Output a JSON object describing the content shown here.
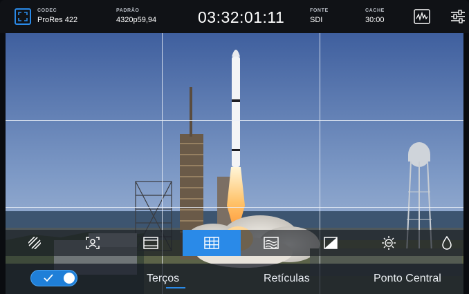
{
  "status_bar": {
    "codec": {
      "key": "CODEC",
      "value": "ProRes 422"
    },
    "standard": {
      "key": "PADRÃO",
      "value": "4320p59,94"
    },
    "timecode": "03:32:01:11",
    "source": {
      "key": "FONTE",
      "value": "SDI"
    },
    "cache": {
      "key": "CACHE",
      "value": "30:00"
    },
    "icons": [
      "fullscreen-icon",
      "waveform-scope-icon",
      "settings-sliders-icon"
    ]
  },
  "tool_strip": {
    "tools": [
      {
        "name": "zebra",
        "icon": "zebra-stripes-icon",
        "active": false
      },
      {
        "name": "focus-assist",
        "icon": "focus-assist-icon",
        "active": false
      },
      {
        "name": "frame-guides",
        "icon": "frame-guides-icon",
        "active": false
      },
      {
        "name": "grids",
        "icon": "grid-icon",
        "active": true
      },
      {
        "name": "false-color",
        "icon": "false-color-icon",
        "active": false
      },
      {
        "name": "exposure",
        "icon": "contrast-icon",
        "active": false
      },
      {
        "name": "brightness",
        "icon": "brightness-gear-icon",
        "active": false
      },
      {
        "name": "color",
        "icon": "droplet-icon",
        "active": false
      }
    ]
  },
  "grid_options": {
    "toggle_on": true,
    "options": [
      {
        "label": "Terços",
        "selected": true
      },
      {
        "label": "Retículas",
        "selected": false
      },
      {
        "label": "Ponto Central",
        "selected": false
      }
    ]
  },
  "colors": {
    "accent": "#2a8ae8",
    "bar_background": "#101216",
    "grid_line": "#ebf0f8"
  }
}
